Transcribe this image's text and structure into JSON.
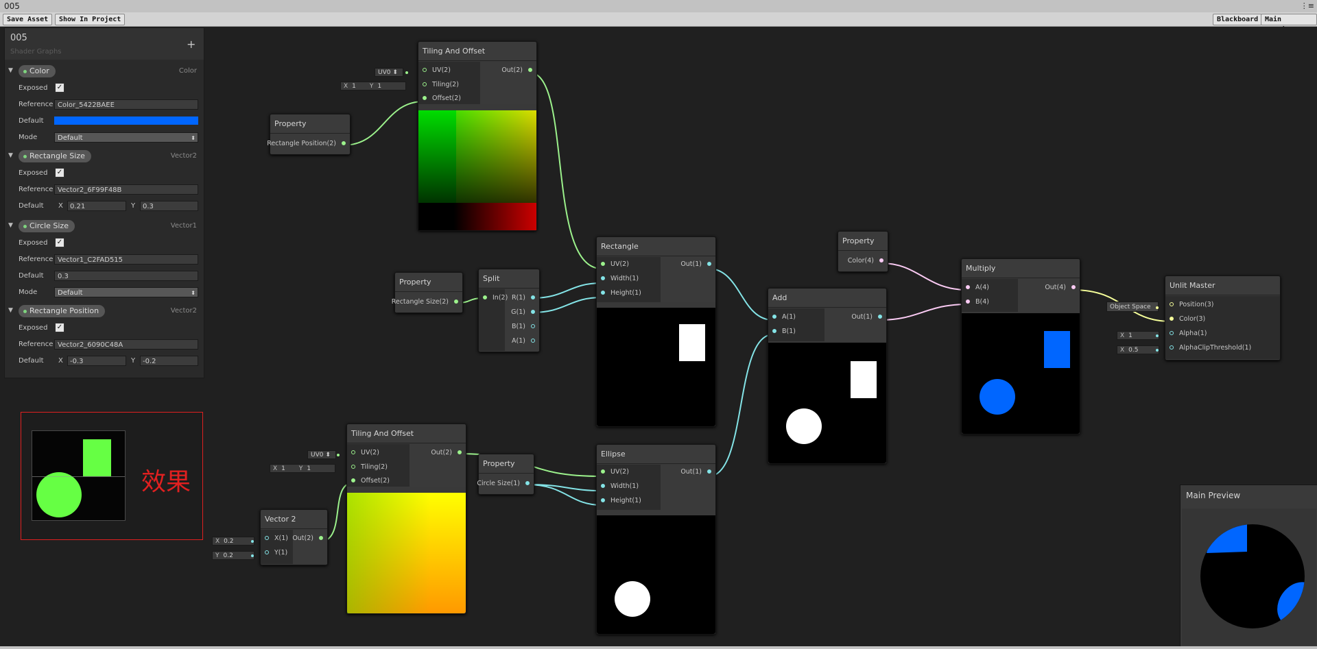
{
  "window": {
    "title": "005",
    "menu_icon": "menu-icon"
  },
  "toolbar": {
    "save_asset": "Save Asset",
    "show_in_project": "Show In Project",
    "blackboard": "Blackboard",
    "main_preview": "Main Preview"
  },
  "blackboard": {
    "title": "005",
    "subtitle": "Shader Graphs",
    "add": "+",
    "labels": {
      "exposed": "Exposed",
      "reference": "Reference",
      "default": "Default",
      "mode": "Mode",
      "x": "X",
      "y": "Y"
    },
    "color_prop": {
      "name": "Color",
      "type": "Color",
      "reference": "Color_5422BAEE",
      "default_color": "#0066ff",
      "mode": "Default"
    },
    "rect_size": {
      "name": "Rectangle Size",
      "type": "Vector2",
      "reference": "Vector2_6F99F48B",
      "x": "0.21",
      "y": "0.3"
    },
    "circle_size": {
      "name": "Circle Size",
      "type": "Vector1",
      "reference": "Vector1_C2FAD515",
      "default": "0.3",
      "mode": "Default"
    },
    "rect_pos": {
      "name": "Rectangle Position",
      "type": "Vector2",
      "reference": "Vector2_6090C48A",
      "x": "-0.3",
      "y": "-0.2"
    }
  },
  "effect": {
    "label": "效果"
  },
  "nodes": {
    "tiling1": {
      "title": "Tiling And Offset",
      "uv": "UV(2)",
      "tiling": "Tiling(2)",
      "offset": "Offset(2)",
      "out": "Out(2)",
      "uv_channel": "UV0",
      "tx_label": "X",
      "tx": "1",
      "ty_label": "Y",
      "ty": "1"
    },
    "prop_rectpos": {
      "title": "Property",
      "out": "Rectangle Position(2)"
    },
    "prop_rectsize": {
      "title": "Property",
      "out": "Rectangle Size(2)"
    },
    "split": {
      "title": "Split",
      "in": "In(2)",
      "r": "R(1)",
      "g": "G(1)",
      "b": "B(1)",
      "a": "A(1)"
    },
    "rectangle": {
      "title": "Rectangle",
      "uv": "UV(2)",
      "width": "Width(1)",
      "height": "Height(1)",
      "out": "Out(1)"
    },
    "prop_color": {
      "title": "Property",
      "out": "Color(4)"
    },
    "add": {
      "title": "Add",
      "a": "A(1)",
      "b": "B(1)",
      "out": "Out(1)"
    },
    "multiply": {
      "title": "Multiply",
      "a": "A(4)",
      "b": "B(4)",
      "out": "Out(4)"
    },
    "master": {
      "title": "Unlit Master",
      "position": "Position(3)",
      "color": "Color(3)",
      "alpha": "Alpha(1)",
      "clip": "AlphaClipThreshold(1)",
      "space": "Object Space",
      "alpha_x": "X",
      "alpha_val": "1",
      "clip_x": "X",
      "clip_val": "0.5"
    },
    "tiling2": {
      "title": "Tiling And Offset",
      "uv": "UV(2)",
      "tiling": "Tiling(2)",
      "offset": "Offset(2)",
      "out": "Out(2)",
      "uv_channel": "UV0",
      "tx_label": "X",
      "tx": "1",
      "ty_label": "Y",
      "ty": "1"
    },
    "prop_circle": {
      "title": "Property",
      "out": "Circle Size(1)"
    },
    "ellipse": {
      "title": "Ellipse",
      "uv": "UV(2)",
      "width": "Width(1)",
      "height": "Height(1)",
      "out": "Out(1)"
    },
    "vector2": {
      "title": "Vector 2",
      "x": "X(1)",
      "y": "Y(1)",
      "out": "Out(2)",
      "x_label": "X",
      "x_val": "0.2",
      "y_label": "Y",
      "y_val": "0.2"
    }
  },
  "main_preview": {
    "title": "Main Preview"
  },
  "colors": {
    "vec2": "#9cf28c",
    "vec1": "#84e4e7",
    "vec4": "#fbcbf4",
    "vec3": "#f6ff9a",
    "accent_blue": "#0066ff",
    "effect_green": "#66ff44",
    "effect_red": "#e02020"
  }
}
